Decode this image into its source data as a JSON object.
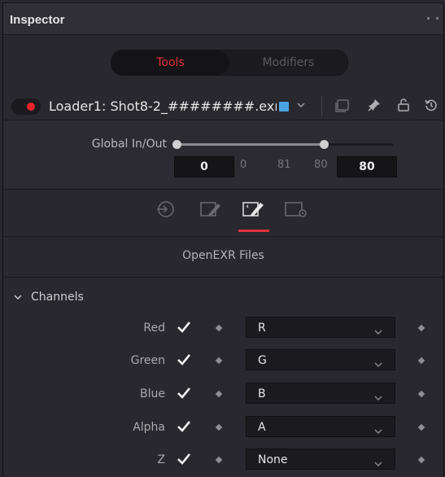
{
  "inspector": {
    "title": "Inspector"
  },
  "tabs": [
    {
      "label": "Tools",
      "active": true
    },
    {
      "label": "Modifiers",
      "active": false
    }
  ],
  "tool": {
    "name": "Loader1: Shot8-2_########.exr",
    "enabled": true,
    "color": "#4aa3e0"
  },
  "global_in_out": {
    "label": "Global In/Out",
    "in_value": "0",
    "range_start": "0",
    "range_end": "81",
    "value_80": "80",
    "out_value": "80",
    "in_fraction": 0.0,
    "out_fraction": 0.988
  },
  "format": {
    "title": "OpenEXR Files"
  },
  "channels": {
    "header": "Channels",
    "rows": [
      {
        "label": "Red",
        "checked": true,
        "value": "R"
      },
      {
        "label": "Green",
        "checked": true,
        "value": "G"
      },
      {
        "label": "Blue",
        "checked": true,
        "value": "B"
      },
      {
        "label": "Alpha",
        "checked": true,
        "value": "A"
      },
      {
        "label": "Z",
        "checked": true,
        "value": "None"
      }
    ]
  },
  "colors": {
    "accent_red": "#e0303a",
    "panel_bg": "#28282e"
  }
}
